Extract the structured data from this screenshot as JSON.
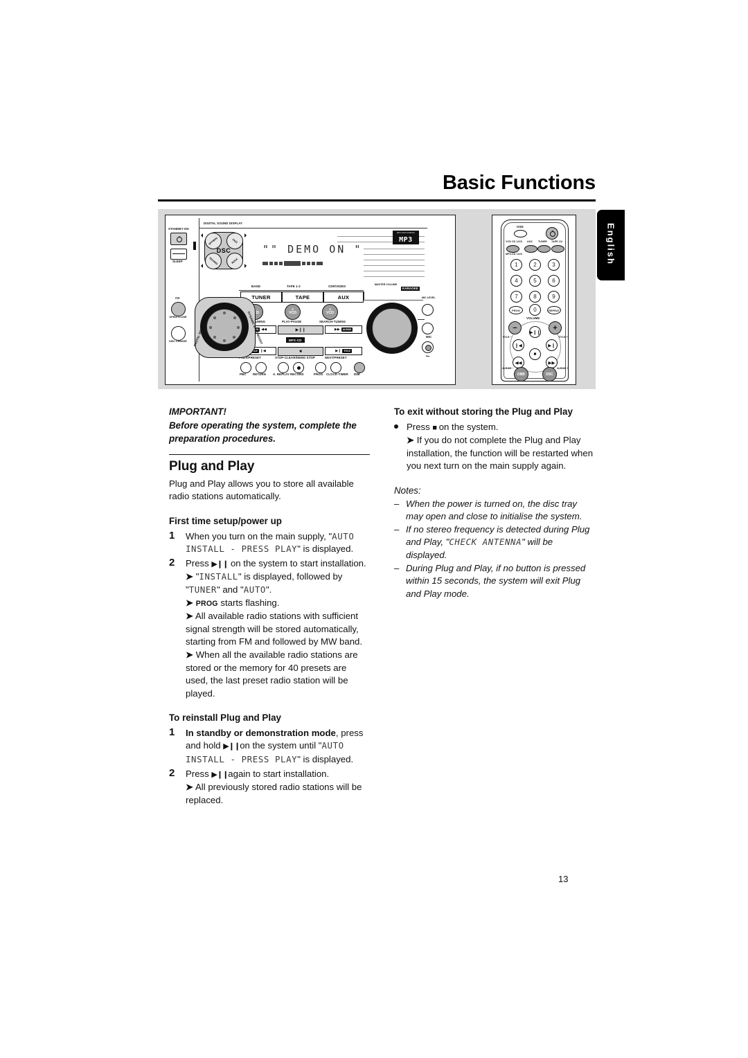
{
  "header": {
    "title": "Basic Functions",
    "language_tab": "English"
  },
  "page_number": "13",
  "illustration": {
    "unit": {
      "standby_label": "STANDBY-ON",
      "sleep_label": "SLEEP",
      "digital_sound_display": "DIGITAL SOUND DISPLAY",
      "dsc_label": "DSC",
      "dsc_modes": [
        "OPTIMAL",
        "JAZZ",
        "ROCK",
        "TECHNO"
      ],
      "lcd_text": "\"\" DEMO ON \"",
      "mp3_logo_top": "MP3-CD PLAYBACK",
      "mp3_logo_main": "MP3",
      "source_captions": [
        "BAND",
        "TAPE 1-2",
        "CDR/VIDEO"
      ],
      "source_buttons": [
        "TUNER",
        "TAPE",
        "AUX"
      ],
      "master_volume_label": "MASTER VOLUME",
      "karaoke_label": "KARAOKE",
      "mtsc_pal_label": "MTSC/ PAL",
      "vcd_knobs": [
        {
          "num": "1",
          "label": "VCD"
        },
        {
          "num": "2",
          "label": "VCD"
        },
        {
          "num": "3",
          "label": "VCD"
        }
      ],
      "transport_captions_top": [
        "SEARCH-TUNING",
        "PLAY-PAUSE",
        "SEARCH-TUNING"
      ],
      "transport_captions_bottom": [
        "PREV/PRESET",
        "STOP-CLEAR/DEMO STOP",
        "NEXT/PRESET"
      ],
      "mp3_cd_tag": "MP3-CD",
      "bottom_buttons": [
        "PBC",
        "RETURN",
        "A. REPLAY",
        "RECORD",
        "PROG",
        "CLOCK-TIMER",
        "DIM"
      ],
      "cd_label": "CD",
      "open_close_label": "OPEN/ CLOSE",
      "disc_change_label": "DISC CHANGE",
      "dial_left_label": "DIGITAL SOUND CONTROL",
      "dial_right_label": "DYNAMIC BASS BOOST",
      "mic_level_label": "MIC LEVEL",
      "mic_label": "MIC"
    },
    "remote": {
      "osd_label": "OSD",
      "source_labels": [
        "VCD CD 1/2/3",
        "AUX",
        "TUNER",
        "TAPE 1/2"
      ],
      "mp3cd_label": "MP3-CD 1/2/3",
      "numbers": [
        "1",
        "2",
        "3",
        "4",
        "5",
        "6",
        "7",
        "8",
        "9"
      ],
      "prog_label": "PROG",
      "zero_label": "0",
      "repeat_label": "REPEAT",
      "volume_label": "VOLUME",
      "volume_minus": "−",
      "volume_plus": "+",
      "title_minus": "TITLE −",
      "title_plus": "TITLE +",
      "album_minus": "ALBUM −",
      "album_plus": "ALBUM +",
      "dbb_label": "DBB",
      "dsc_label": "DSC",
      "play_pause_glyph": "▶❙❙",
      "prev_glyph": "❙◀",
      "next_glyph": "▶❙",
      "rew_glyph": "◀◀",
      "ffwd_glyph": "▶▶",
      "stop_glyph": "■"
    }
  },
  "left_column": {
    "important_title": "IMPORTANT!",
    "important_body": "Before operating the system, complete the preparation procedures.",
    "section_title": "Plug and Play",
    "section_intro": "Plug and Play allows you to store all available radio stations automatically.",
    "first_time": {
      "heading": "First time setup/power up",
      "step1_num": "1",
      "step1_a": "When you turn on the main supply, \"",
      "step1_lcd": "AUTO INSTALL - PRESS PLAY",
      "step1_b": "\" is displayed.",
      "step2_num": "2",
      "step2_text_a": "Press",
      "step2_glyph": "▶❙❙",
      "step2_text_b": "on the system to start installation.",
      "r1_a": "\"",
      "r1_lcd1": "INSTALL",
      "r1_b": "\" is displayed, followed by \"",
      "r1_lcd2": "TUNER",
      "r1_c": "\" and \"",
      "r1_lcd3": "AUTO",
      "r1_d": "\".",
      "r2_sc": "PROG",
      "r2_text": "starts flashing.",
      "r3": "All available radio stations with sufficient signal strength will be stored automatically, starting from FM and followed by MW band.",
      "r4": "When all the available radio stations are stored or the memory for 40 presets are used, the last preset radio station will be played."
    },
    "reinstall": {
      "heading": "To reinstall Plug and Play",
      "step1_num": "1",
      "step1_bold": "In standby or demonstration mode",
      "step1_a": ", press and hold",
      "step1_glyph": "▶❙❙",
      "step1_b": "on the system until \"",
      "step1_lcd": "AUTO INSTALL - PRESS PLAY",
      "step1_c": "\" is displayed.",
      "step2_num": "2",
      "step2_a": "Press",
      "step2_glyph": "▶❙❙",
      "step2_b": "again to start installation.",
      "r1": "All previously stored radio stations will be replaced."
    }
  },
  "right_column": {
    "exit": {
      "heading": "To exit without storing the Plug and Play",
      "bullet_a": "Press",
      "bullet_glyph": "■",
      "bullet_b": "on the system.",
      "arrow1": "If you do not complete the Plug and Play installation, the function will be restarted when you next turn on the main supply again."
    },
    "notes": {
      "title": "Notes:",
      "items": [
        {
          "text_a": "When the power is turned on, the disc tray may open and close to initialise the system.",
          "lcd": "",
          "text_b": ""
        },
        {
          "text_a": "If no stereo frequency is detected during Plug and Play, \"",
          "lcd": "CHECK ANTENNA",
          "text_b": "\" will be displayed."
        },
        {
          "text_a": "During Plug and Play, if no button is pressed within 15 seconds, the system will exit Plug and Play mode.",
          "lcd": "",
          "text_b": ""
        }
      ]
    }
  }
}
